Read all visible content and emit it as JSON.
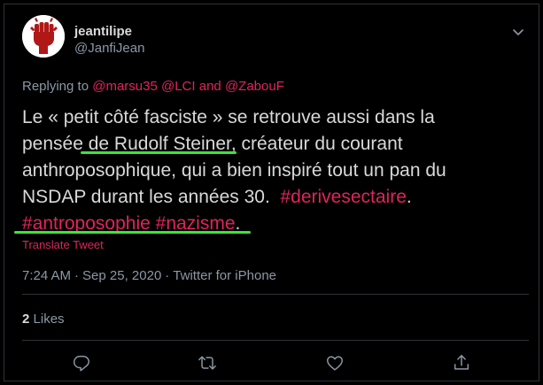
{
  "author": {
    "display_name": "jeantilipe",
    "handle": "@JanfiJean"
  },
  "reply": {
    "prefix": "Replying to ",
    "mention1": "@marsu35",
    "mention2": "@LCI",
    "and": " and ",
    "mention3": "@ZabouF"
  },
  "tweet": {
    "line1": "Le « petit côté fasciste » se retrouve aussi dans la",
    "line2a": "pensée ",
    "line2b": "de Rudolf Steiner",
    "line2c": ", créateur du courant",
    "line3": "anthroposophique, qui a bien inspiré tout un pan du",
    "line4": "NSDAP durant les années 30.  ",
    "hashtag1": "#derivesectaire",
    "line4end": ".",
    "hashtag2": "#antroposophie",
    "space": " ",
    "hashtag3": "#nazisme",
    "line5end": "."
  },
  "translate_label": "Translate Tweet",
  "meta": {
    "time": "7:24 AM",
    "sep": "·",
    "date": "Sep 25, 2020",
    "source": "Twitter for iPhone"
  },
  "likes": {
    "count": "2",
    "label": "Likes"
  },
  "actions": [
    "reply-icon",
    "retweet-icon",
    "like-icon",
    "share-icon"
  ],
  "colors": {
    "background": "#000000",
    "accent": "#e0245e",
    "secondary_text": "#8b98a5",
    "highlight": "#39e639"
  }
}
